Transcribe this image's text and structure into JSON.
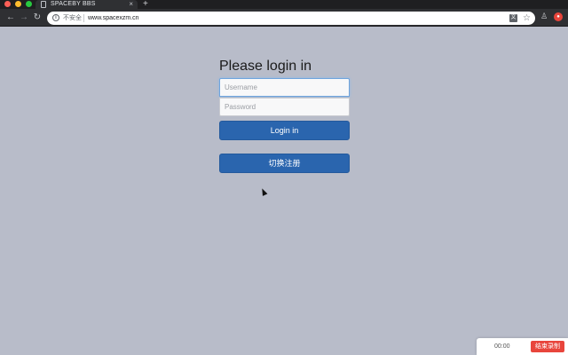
{
  "browser": {
    "tab_title": "SPACEBY BBS",
    "tab_close": "×",
    "new_tab": "+",
    "nav": {
      "back": "←",
      "forward": "→",
      "reload": "↻"
    },
    "security_label": "不安全",
    "url": "www.spacexzm.cn",
    "icons": {
      "star": "☆"
    }
  },
  "login": {
    "title": "Please login in",
    "username_placeholder": "Username",
    "password_placeholder": "Password",
    "login_button": "Login in",
    "switch_register_button": "切换注册"
  },
  "recorder": {
    "time": "00:00",
    "stop_label": "结束录制"
  },
  "colors": {
    "page_background": "#b8bcc9",
    "primary_button": "#2a65ae",
    "record_stop": "#e8453c"
  }
}
